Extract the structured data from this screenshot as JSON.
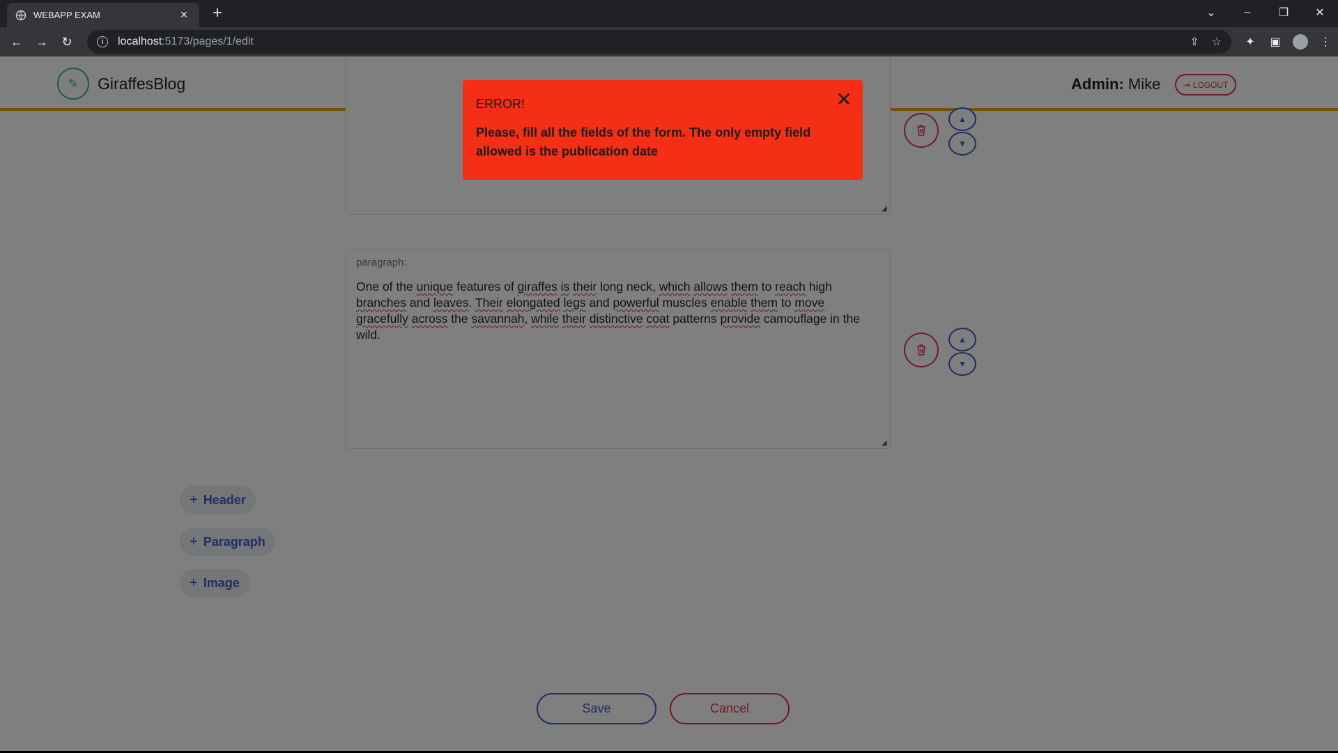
{
  "browser": {
    "tab_title": "WEBAPP EXAM",
    "url_host": "localhost",
    "url_path": ":5173/pages/1/edit"
  },
  "app": {
    "brand": "GiraffesBlog",
    "admin_label": "Admin:",
    "admin_name": "Mike",
    "logout_label": "LOGOUT"
  },
  "editor": {
    "blocks": [
      {
        "label": "",
        "text": ""
      },
      {
        "label": "paragraph:",
        "text": "One of the unique features of giraffes is their long neck, which allows them to reach high branches and leaves. Their elongated legs and powerful muscles enable them to move gracefully across the savannah, while their distinctive coat patterns provide camouflage in the wild."
      }
    ],
    "add_buttons": [
      "Header",
      "Paragraph",
      "Image"
    ],
    "save_label": "Save",
    "cancel_label": "Cancel"
  },
  "toast": {
    "title": "ERROR!",
    "message": "Please, fill all the fields of the form. The only empty field allowed is the publication date"
  },
  "colors": {
    "accent_blue": "#3d5bc7",
    "danger_red": "#dc3545",
    "brand_green": "#2fb889",
    "navbar_border": "#e3a21a",
    "toast_bg": "#f52f16"
  }
}
